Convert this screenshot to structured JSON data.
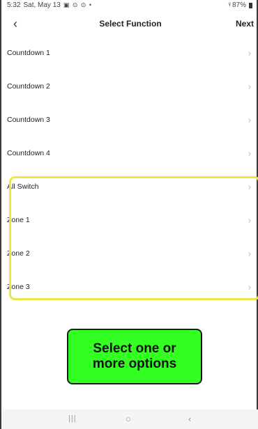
{
  "status_bar": {
    "time": "5:32",
    "date": "Sat, May 13",
    "icons": "▣ ⊙ ⊙ •",
    "battery": "87%"
  },
  "header": {
    "back": "‹",
    "title": "Select Function",
    "next": "Next"
  },
  "list": {
    "items": [
      {
        "label": "Countdown 1",
        "chevron": "›"
      },
      {
        "label": "Countdown 2",
        "chevron": "›"
      },
      {
        "label": "Countdown 3",
        "chevron": "›"
      },
      {
        "label": "Countdown 4",
        "chevron": "›"
      },
      {
        "label": "All Switch",
        "chevron": "›"
      },
      {
        "label": "Zone 1",
        "chevron": "›"
      },
      {
        "label": "Zone 2",
        "chevron": "›"
      },
      {
        "label": "Zone 3",
        "chevron": "›"
      }
    ]
  },
  "callout": {
    "text": "Select one or more options"
  },
  "nav_bar": {
    "recents": "|||",
    "home": "○",
    "back": "‹"
  },
  "colors": {
    "highlight": "#e8e84a",
    "callout_bg": "#33ff22"
  }
}
